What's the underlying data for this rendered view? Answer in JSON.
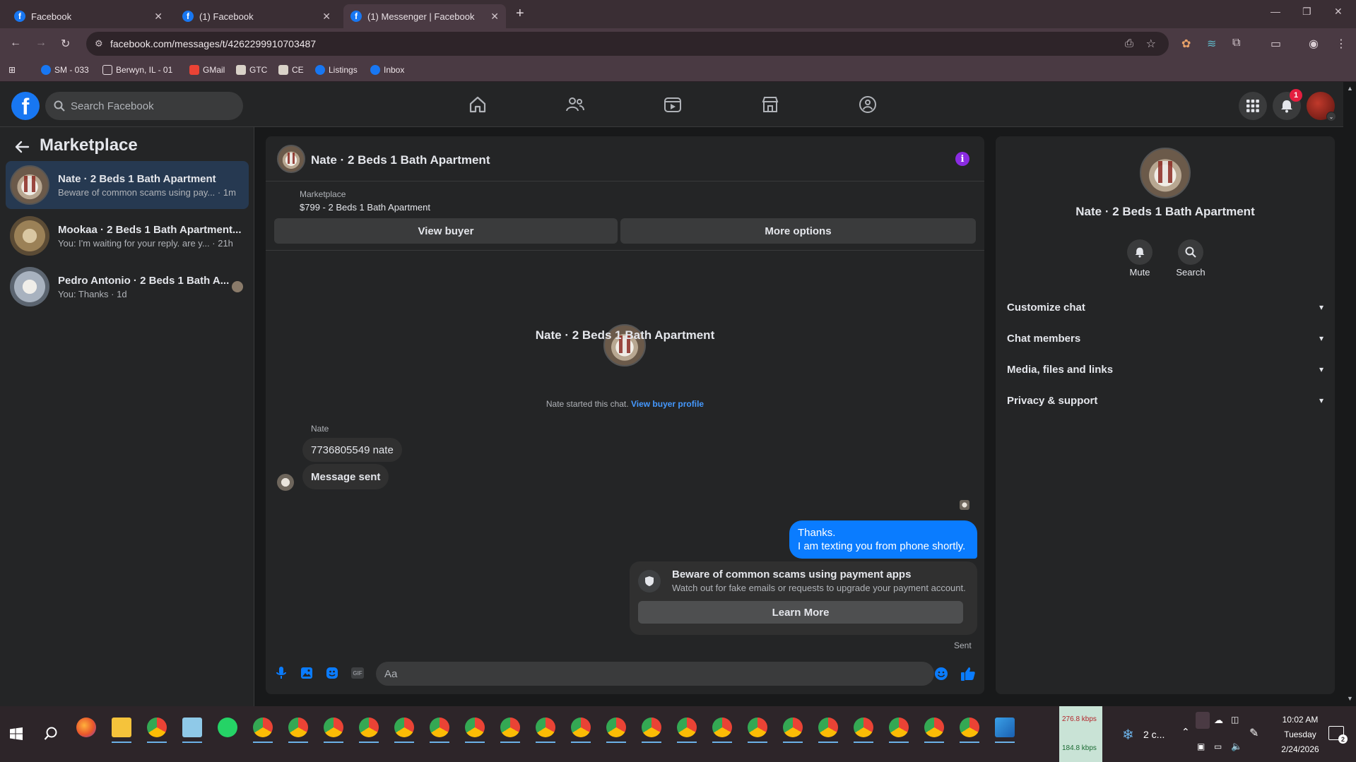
{
  "browser": {
    "tabs": [
      {
        "title": "Facebook"
      },
      {
        "title": "(1) Facebook"
      },
      {
        "title": "(1) Messenger | Facebook"
      }
    ],
    "url": "facebook.com/messages/t/4262299910703487",
    "bookmarks": [
      {
        "label": "SM - 033"
      },
      {
        "label": "Berwyn, IL - 01"
      },
      {
        "label": "GMail"
      },
      {
        "label": "GTC"
      },
      {
        "label": "CE"
      },
      {
        "label": "Listings"
      },
      {
        "label": "Inbox"
      }
    ]
  },
  "fb": {
    "search_placeholder": "Search Facebook",
    "notifications_count": "1"
  },
  "sidebar": {
    "title": "Marketplace",
    "conversations": [
      {
        "name": "Nate · 2 Beds 1 Bath Apartment",
        "preview": "Beware of common scams using pay... · 1m"
      },
      {
        "name": "Mookaa · 2 Beds 1 Bath Apartment...",
        "preview": "You: I'm waiting for your reply. are y... · 21h"
      },
      {
        "name": "Pedro Antonio · 2 Beds 1 Bath A...",
        "preview": "You: Thanks · 1d"
      }
    ]
  },
  "chat": {
    "header_title": "Nate · 2 Beds 1 Bath Apartment",
    "listing_source": "Marketplace",
    "listing_line": "$799 - 2 Beds 1 Bath Apartment",
    "view_buyer": "View buyer",
    "more_options": "More options",
    "profile_name": "Nate · 2 Beds 1 Bath Apartment",
    "started_text": "Nate started this chat.",
    "view_buyer_profile": "View buyer profile",
    "sender_name": "Nate",
    "incoming": [
      {
        "text": "7736805549 nate"
      },
      {
        "text": "Message sent"
      }
    ],
    "outgoing_line1": "Thanks.",
    "outgoing_line2": "I am texting you from phone shortly.",
    "warning_title": "Beware of common scams using payment apps",
    "warning_body": "Watch out for fake emails or requests to upgrade your payment account.",
    "learn_more": "Learn More",
    "sent_status": "Sent",
    "composer_placeholder": "Aa"
  },
  "info": {
    "name": "Nate · 2 Beds 1 Bath Apartment",
    "mute": "Mute",
    "search": "Search",
    "sections": [
      {
        "label": "Customize chat"
      },
      {
        "label": "Chat members"
      },
      {
        "label": "Media, files and links"
      },
      {
        "label": "Privacy & support"
      }
    ]
  },
  "taskbar": {
    "net_up": "276.8 kbps",
    "net_down": "184.8 kbps",
    "weather": "2 c...",
    "time": "10:02 AM",
    "day": "Tuesday",
    "date": "2/24/2026",
    "notif_count": "2"
  },
  "colors": {
    "fb_blue": "#1877f2",
    "bg": "#18191a",
    "panel": "#242526",
    "outgoing_bubble": "#0a7cff",
    "link": "#4599ff"
  }
}
